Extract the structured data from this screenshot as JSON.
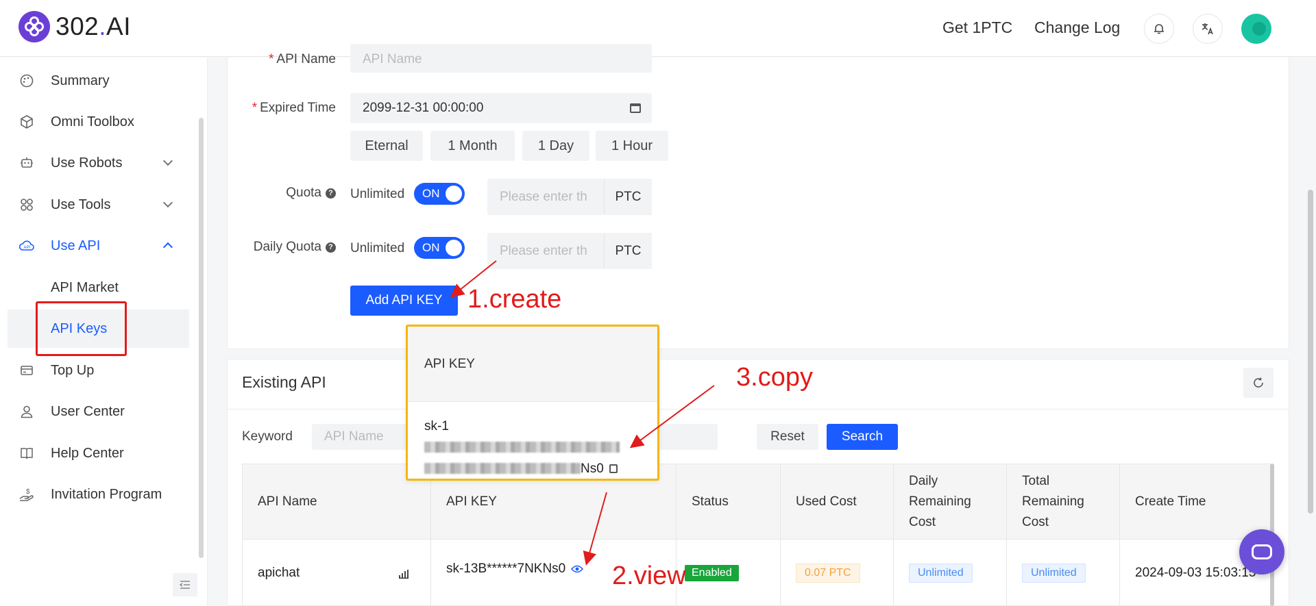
{
  "header": {
    "logo_num": "302",
    "logo_dot": ".",
    "logo_ai": "AI",
    "get_ptc": "Get 1PTC",
    "change_log": "Change Log"
  },
  "sidebar": {
    "items": [
      {
        "label": "Summary",
        "icon": "palette-icon"
      },
      {
        "label": "Omni Toolbox",
        "icon": "cube-icon"
      },
      {
        "label": "Use Robots",
        "icon": "robot-icon"
      },
      {
        "label": "Use Tools",
        "icon": "grid-icon"
      },
      {
        "label": "Use API",
        "icon": "cloud-api-icon"
      },
      {
        "label": "API Market"
      },
      {
        "label": "API Keys"
      },
      {
        "label": "Top Up",
        "icon": "card-icon"
      },
      {
        "label": "User Center",
        "icon": "user-icon"
      },
      {
        "label": "Help Center",
        "icon": "book-icon"
      },
      {
        "label": "Invitation Program",
        "icon": "gift-icon"
      }
    ]
  },
  "form": {
    "api_name_label": "API Name",
    "api_name_placeholder": "API Name",
    "expired_label": "Expired Time",
    "expired_value": "2099-12-31 00:00:00",
    "durations": [
      "Eternal",
      "1 Month",
      "1 Day",
      "1 Hour"
    ],
    "quota_label": "Quota",
    "daily_quota_label": "Daily Quota",
    "unlimited": "Unlimited",
    "toggle_on": "ON",
    "quota_placeholder": "Please enter th",
    "unit": "PTC",
    "add_button": "Add API KEY"
  },
  "existing": {
    "title": "Existing API",
    "keyword_label": "Keyword",
    "keyword_placeholder": "API Name",
    "reset": "Reset",
    "search": "Search"
  },
  "table": {
    "headers": [
      "API Name",
      "API KEY",
      "Status",
      "Used Cost",
      "Daily Remaining Cost",
      "Total Remaining Cost",
      "Create Time"
    ],
    "row": {
      "name": "apichat",
      "key": "sk-13B******7NKNs0",
      "status": "Enabled",
      "used": "0.07 PTC",
      "daily": "Unlimited",
      "total": "Unlimited",
      "created": "2024-09-03 15:03:15"
    }
  },
  "popup": {
    "title": "API KEY",
    "key_start": "sk-1",
    "key_end": "Ns0"
  },
  "annotations": {
    "create": "1.create",
    "view": "2.view",
    "copy": "3.copy"
  },
  "colors": {
    "accent": "#1a5cff",
    "brand": "#6b3fd6",
    "annotation": "#e21b1b",
    "popup_border": "#f5b70c"
  }
}
